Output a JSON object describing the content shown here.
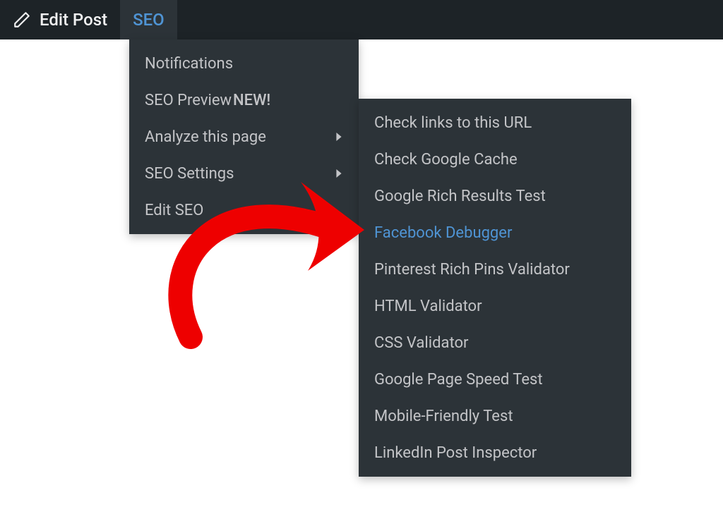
{
  "topbar": {
    "edit_post_label": "Edit Post",
    "seo_label": "SEO"
  },
  "seo_menu": {
    "items": [
      {
        "label": "Notifications",
        "has_submenu": false,
        "badge": ""
      },
      {
        "label": "SEO Preview",
        "has_submenu": false,
        "badge": "NEW!"
      },
      {
        "label": "Analyze this page",
        "has_submenu": true,
        "badge": ""
      },
      {
        "label": "SEO Settings",
        "has_submenu": true,
        "badge": ""
      },
      {
        "label": "Edit SEO",
        "has_submenu": false,
        "badge": ""
      }
    ]
  },
  "analyze_submenu": {
    "items": [
      {
        "label": "Check links to this URL",
        "highlight": false
      },
      {
        "label": "Check Google Cache",
        "highlight": false
      },
      {
        "label": "Google Rich Results Test",
        "highlight": false
      },
      {
        "label": "Facebook Debugger",
        "highlight": true
      },
      {
        "label": "Pinterest Rich Pins Validator",
        "highlight": false
      },
      {
        "label": "HTML Validator",
        "highlight": false
      },
      {
        "label": "CSS Validator",
        "highlight": false
      },
      {
        "label": "Google Page Speed Test",
        "highlight": false
      },
      {
        "label": "Mobile-Friendly Test",
        "highlight": false
      },
      {
        "label": "LinkedIn Post Inspector",
        "highlight": false
      }
    ]
  },
  "colors": {
    "topbar_bg": "#1d2327",
    "menu_bg": "#2c3338",
    "text": "#c3c4c7",
    "accent": "#4f94d4",
    "annotation": "#ee0000"
  }
}
